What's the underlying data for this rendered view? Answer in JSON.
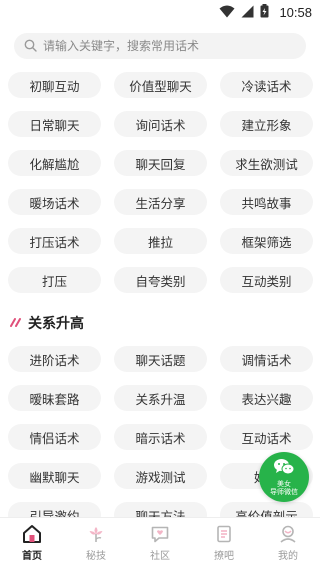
{
  "status_bar": {
    "time": "10:58"
  },
  "search": {
    "placeholder": "请输入关键字，搜索常用话术"
  },
  "categories_1": [
    "初聊互动",
    "价值型聊天",
    "冷读话术",
    "日常聊天",
    "询问话术",
    "建立形象",
    "化解尴尬",
    "聊天回复",
    "求生欲测试",
    "暖场话术",
    "生活分享",
    "共鸣故事",
    "打压话术",
    "推拉",
    "框架筛选",
    "打压",
    "自夸类别",
    "互动类别"
  ],
  "section_2": {
    "title": "关系升高",
    "items": [
      "进阶话术",
      "聊天话题",
      "调情话术",
      "暧昧套路",
      "关系升温",
      "表达兴趣",
      "情侣话术",
      "暗示话术",
      "互动话术",
      "幽默聊天",
      "游戏测试",
      "好感",
      "引导邀约",
      "聊天方法",
      "高价值剖示"
    ]
  },
  "fab": {
    "line1": "美女",
    "line2": "导师微信"
  },
  "nav": [
    {
      "label": "首页",
      "icon": "home-icon",
      "active": true
    },
    {
      "label": "秘技",
      "icon": "flower-icon",
      "active": false
    },
    {
      "label": "社区",
      "icon": "community-chat-icon",
      "active": false
    },
    {
      "label": "撩吧",
      "icon": "article-icon",
      "active": false
    },
    {
      "label": "我的",
      "icon": "profile-icon",
      "active": false
    }
  ],
  "colors": {
    "accent": "#e0507a",
    "chip_bg": "#f4f4f4",
    "fab_green": "#27b34a",
    "text": "#333333"
  }
}
